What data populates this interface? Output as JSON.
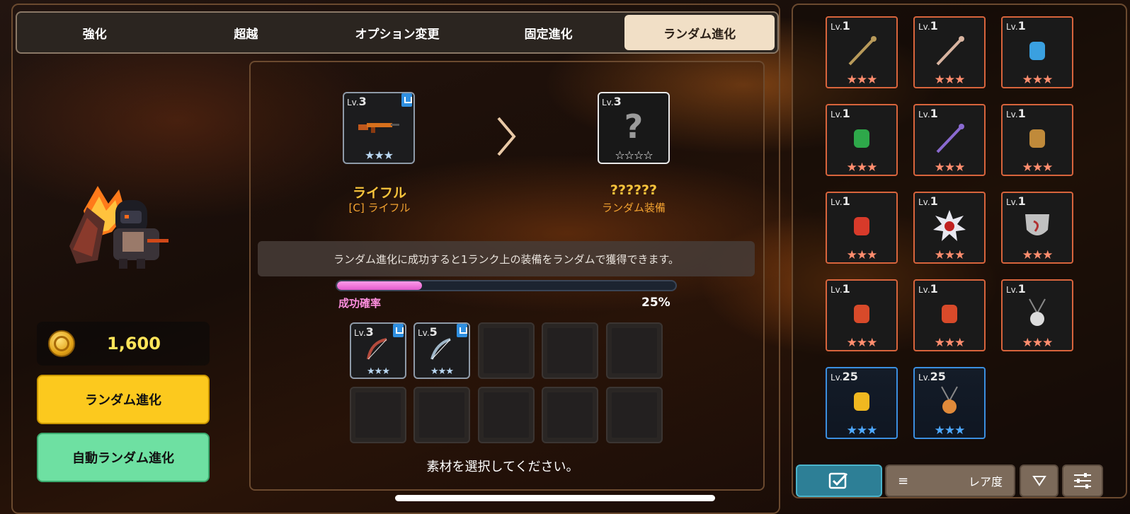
{
  "tabs": [
    {
      "label": "強化",
      "active": false
    },
    {
      "label": "超越",
      "active": false
    },
    {
      "label": "オプション変更",
      "active": false
    },
    {
      "label": "固定進化",
      "active": false
    },
    {
      "label": "ランダム進化",
      "active": true
    }
  ],
  "gold": {
    "amount": "1,600"
  },
  "buttons": {
    "random_evolve": "ランダム進化",
    "auto_random_evolve": "自動ランダム進化"
  },
  "source_item": {
    "lv_prefix": "Lv.",
    "level": "3",
    "name": "ライフル",
    "subname": "[C] ライフル",
    "stars": "★★★"
  },
  "result_item": {
    "lv_prefix": "Lv.",
    "level": "3",
    "name": "??????",
    "subname": "ランダム装備",
    "placeholder": "?",
    "stars": "☆☆☆☆"
  },
  "info_text": "ランダム進化に成功すると1ランク上の装備をランダムで獲得できます。",
  "success_rate": {
    "label": "成功確率",
    "value": "25%",
    "fraction": 0.25
  },
  "materials": [
    {
      "lv_prefix": "Lv.",
      "level": "3",
      "stars": "★★★"
    },
    {
      "lv_prefix": "Lv.",
      "level": "5",
      "stars": "★★★"
    }
  ],
  "select_hint": "素材を選択してください。",
  "inventory": [
    {
      "lv_prefix": "Lv.",
      "level": "1",
      "stars": "★★★",
      "rarity": "orange",
      "icon": "rifle-icon"
    },
    {
      "lv_prefix": "Lv.",
      "level": "1",
      "stars": "★★★",
      "rarity": "orange",
      "icon": "spear-icon"
    },
    {
      "lv_prefix": "Lv.",
      "level": "1",
      "stars": "★★★",
      "rarity": "orange",
      "icon": "helmet-icon"
    },
    {
      "lv_prefix": "Lv.",
      "level": "1",
      "stars": "★★★",
      "rarity": "orange",
      "icon": "frog-icon"
    },
    {
      "lv_prefix": "Lv.",
      "level": "1",
      "stars": "★★★",
      "rarity": "orange",
      "icon": "staff-icon"
    },
    {
      "lv_prefix": "Lv.",
      "level": "1",
      "stars": "★★★",
      "rarity": "orange",
      "icon": "glove-icon"
    },
    {
      "lv_prefix": "Lv.",
      "level": "1",
      "stars": "★★★",
      "rarity": "orange",
      "icon": "armor-icon"
    },
    {
      "lv_prefix": "Lv.",
      "level": "1",
      "stars": "★★★",
      "rarity": "orange",
      "icon": "spiked-orb-icon"
    },
    {
      "lv_prefix": "Lv.",
      "level": "1",
      "stars": "★★★",
      "rarity": "orange",
      "icon": "shield-icon"
    },
    {
      "lv_prefix": "Lv.",
      "level": "1",
      "stars": "★★★",
      "rarity": "orange",
      "icon": "gauntlet-icon"
    },
    {
      "lv_prefix": "Lv.",
      "level": "1",
      "stars": "★★★",
      "rarity": "orange",
      "icon": "gauntlet-icon"
    },
    {
      "lv_prefix": "Lv.",
      "level": "1",
      "stars": "★★★",
      "rarity": "orange",
      "icon": "pendant-icon"
    },
    {
      "lv_prefix": "Lv.",
      "level": "25",
      "stars": "★★★",
      "rarity": "blue",
      "icon": "seahorse-icon"
    },
    {
      "lv_prefix": "Lv.",
      "level": "25",
      "stars": "★★★",
      "rarity": "blue",
      "icon": "amulet-icon"
    }
  ],
  "sort": {
    "label": "レア度"
  },
  "colors": {
    "tab_active": "#f1dfc6",
    "button_yellow": "#fcc91e",
    "button_green": "#6ee0a2",
    "progress_pink": "#e25bcd",
    "rarity_orange": "#d8643c",
    "rarity_blue": "#3b8fe0"
  }
}
